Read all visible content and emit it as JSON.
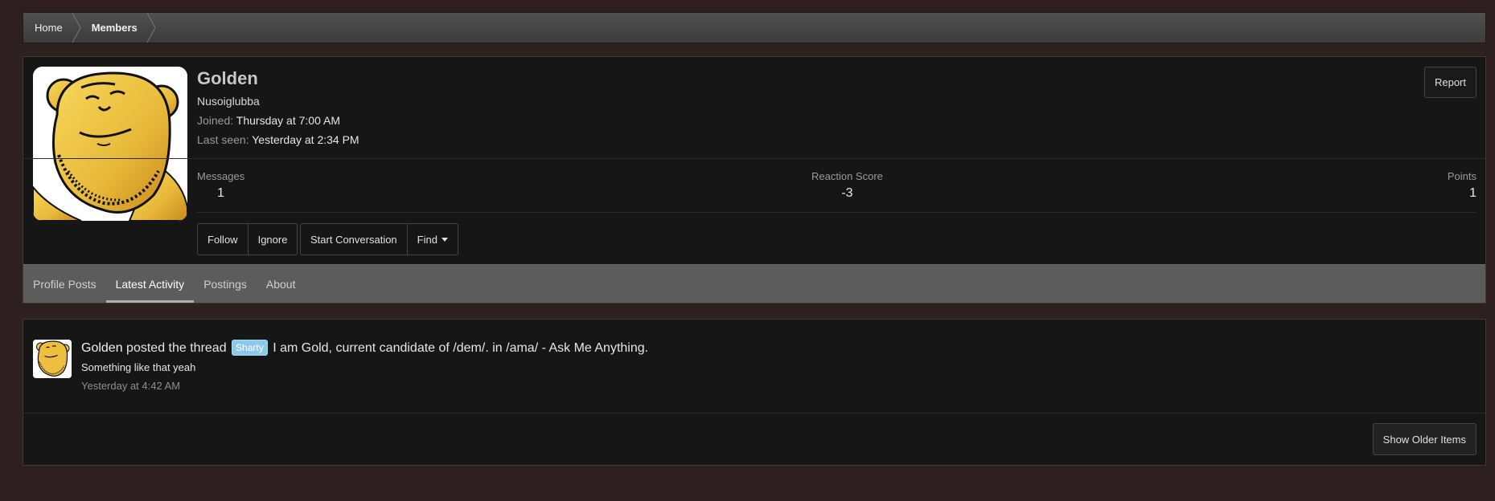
{
  "breadcrumb": {
    "items": [
      {
        "label": "Home"
      },
      {
        "label": "Members"
      }
    ]
  },
  "profile": {
    "name": "Golden",
    "user_title": "Nusoiglubba",
    "joined_label": "Joined:",
    "joined_value": "Thursday at 7:00 AM",
    "last_seen_label": "Last seen:",
    "last_seen_value": "Yesterday at 2:34 PM",
    "report_label": "Report",
    "stats": {
      "messages": {
        "label": "Messages",
        "value": "1"
      },
      "reaction_score": {
        "label": "Reaction Score",
        "value": "-3"
      },
      "points": {
        "label": "Points",
        "value": "1"
      }
    },
    "buttons": {
      "follow": "Follow",
      "ignore": "Ignore",
      "start_conversation": "Start Conversation",
      "find": "Find"
    }
  },
  "tabs": [
    {
      "label": "Profile Posts",
      "active": false
    },
    {
      "label": "Latest Activity",
      "active": true
    },
    {
      "label": "Postings",
      "active": false
    },
    {
      "label": "About",
      "active": false
    }
  ],
  "activity": {
    "user": "Golden",
    "action_text": "posted the thread",
    "prefix": "Sharty",
    "thread_title": "I am Gold, current candidate of /dem/.",
    "in_text": "in",
    "forum": "/ama/ - Ask Me Anything.",
    "snippet": "Something like that yeah",
    "time": "Yesterday at 4:42 AM",
    "older_label": "Show Older Items"
  },
  "colors": {
    "page_bg": "#2e2020",
    "block_bg": "#171616",
    "tab_bar_bg": "#5c5c5c",
    "prefix_bg": "#8cc9ea"
  },
  "icons": {
    "avatar": "golden-face-avatar",
    "find_caret": "caret-down-icon"
  }
}
